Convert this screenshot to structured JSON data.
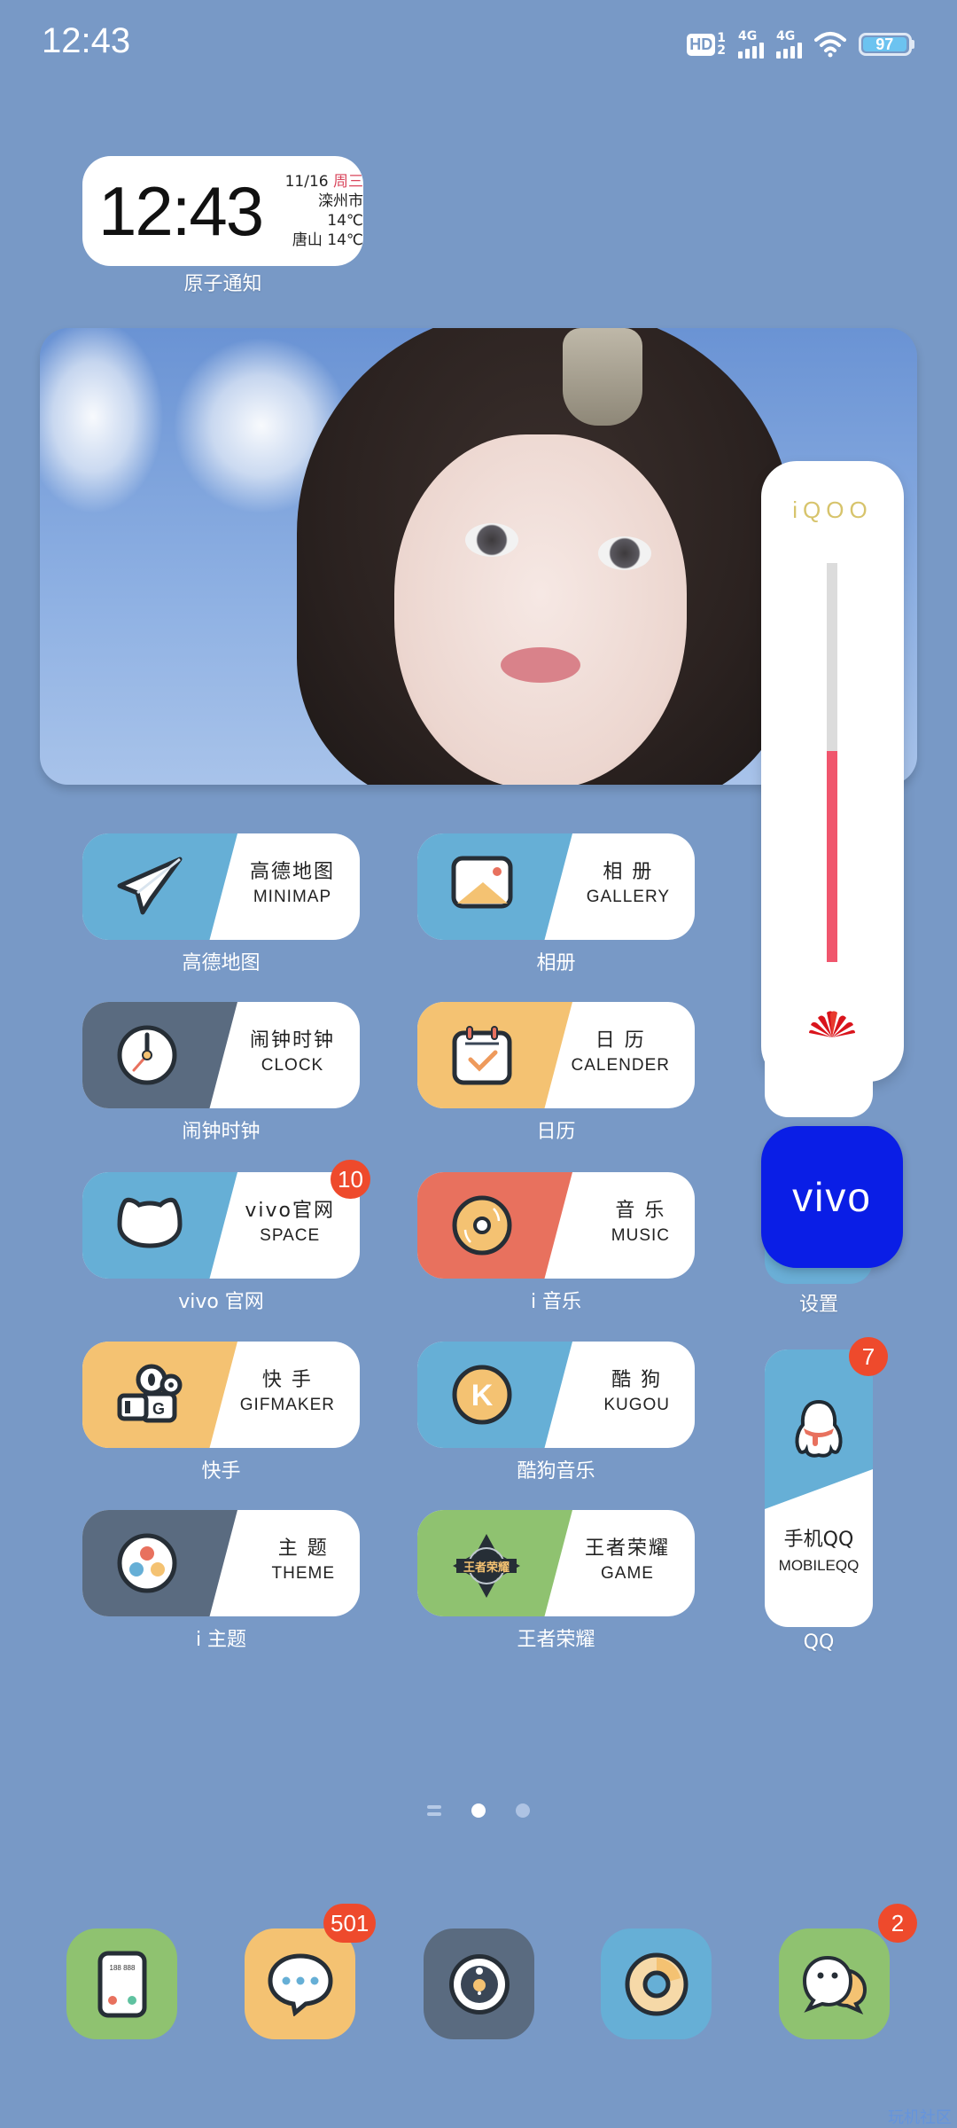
{
  "status_bar": {
    "time": "12:43",
    "hd_label": "HD",
    "hd_sub": [
      "1",
      "2"
    ],
    "sim1": "4G",
    "sim2": "4G",
    "battery": "97",
    "icons": [
      "hd-voice-icon",
      "signal-4g-icon",
      "signal-4g-icon",
      "wifi-icon",
      "battery-icon"
    ]
  },
  "clock_widget": {
    "time": "12:43",
    "date": "11/16",
    "weekday": "周三",
    "weather_1": "滦州市 14℃",
    "weather_2": "唐山 14℃",
    "label": "原子通知"
  },
  "memory_widget": {
    "brand": "iQOO",
    "usage_fraction": 0.53,
    "fill_color": "#f0566d"
  },
  "apps": [
    {
      "cn": "高德地图",
      "en": "MINIMAP",
      "label": "高德地图",
      "color": "#66afd6",
      "icon": "paper-plane-icon"
    },
    {
      "cn": "相 册",
      "en": "GALLERY",
      "label": "相册",
      "color": "#66afd6",
      "icon": "photo-icon"
    },
    {
      "cn": "闹钟时钟",
      "en": "CLOCK",
      "label": "闹钟时钟",
      "color": "#5a6b80",
      "icon": "clock-icon"
    },
    {
      "cn": "日 历",
      "en": "CALENDER",
      "label": "日历",
      "color": "#f4c272",
      "icon": "calendar-icon"
    },
    {
      "cn": "vivo官网",
      "en": "SPACE",
      "label": "vivo 官网",
      "color": "#66afd6",
      "icon": "cat-head-icon",
      "badge": "10"
    },
    {
      "cn": "音 乐",
      "en": "MUSIC",
      "label": "i 音乐",
      "color": "#e8715e",
      "icon": "vinyl-disc-icon"
    },
    {
      "cn": "快 手",
      "en": "GIFMAKER",
      "label": "快手",
      "color": "#f4c272",
      "icon": "video-camera-icon"
    },
    {
      "cn": "酷 狗",
      "en": "KUGOU",
      "label": "酷狗音乐",
      "color": "#66afd6",
      "icon": "kugou-k-icon"
    },
    {
      "cn": "主 题",
      "en": "THEME",
      "label": "i 主题",
      "color": "#5a6b80",
      "icon": "palette-icon"
    },
    {
      "cn": "王者荣耀",
      "en": "GAME",
      "label": "王者荣耀",
      "color": "#8fc270",
      "icon": "game-emblem-icon"
    }
  ],
  "right_column": {
    "settings_label": "设置",
    "vivo_logo": "vivo",
    "qq": {
      "cn": "手机QQ",
      "en": "MOBILEQQ",
      "label": "QQ",
      "badge": "7"
    }
  },
  "app_icon_text": {
    "game_emblem": "王者荣耀",
    "kugou": "K"
  },
  "page_indicator": {
    "pages": 2,
    "current": 0
  },
  "dock": [
    {
      "name": "phone",
      "icon": "phone-icon",
      "color": "#8fc270",
      "screen_text": "188 888"
    },
    {
      "name": "messages",
      "icon": "message-bubble-icon",
      "color": "#f4c272",
      "badge": "501"
    },
    {
      "name": "camera",
      "icon": "camera-icon",
      "color": "#5a6b80"
    },
    {
      "name": "browser",
      "icon": "donut-browser-icon",
      "color": "#66afd6"
    },
    {
      "name": "wechat",
      "icon": "wechat-icon",
      "color": "#8fc270",
      "badge": "2"
    }
  ],
  "watermark": "玩机社区"
}
